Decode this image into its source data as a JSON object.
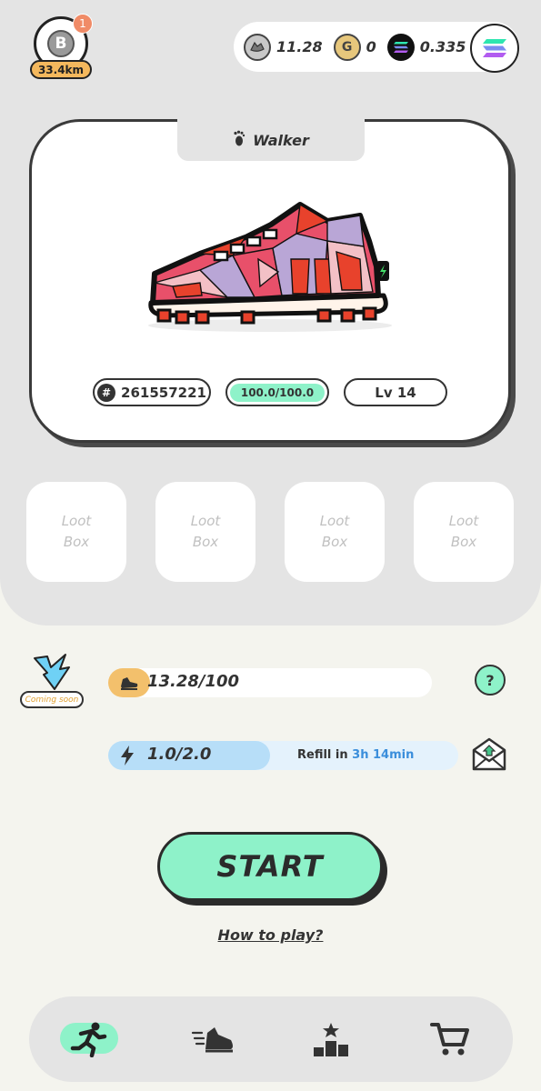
{
  "header": {
    "btc_badge": {
      "coin": "B",
      "notifications": "1",
      "distance": "33.4km"
    },
    "balances": [
      {
        "icon": "gst-token-icon",
        "value": "11.28"
      },
      {
        "icon": "gmt-token-icon",
        "value": "0",
        "symbol": "G"
      },
      {
        "icon": "sol-token-icon",
        "value": "0.335"
      }
    ]
  },
  "sneaker": {
    "type_label": "Walker",
    "id": "261557221",
    "id_prefix": "#",
    "durability": "100.0/100.0",
    "level": "Lv 14",
    "colors": {
      "primary": "#e8506a",
      "secondary": "#b9a6d6",
      "accent": "#e8422c",
      "light": "#f3c0c6"
    }
  },
  "loot_boxes": [
    {
      "label_1": "Loot",
      "label_2": "Box"
    },
    {
      "label_1": "Loot",
      "label_2": "Box"
    },
    {
      "label_1": "Loot",
      "label_2": "Box"
    },
    {
      "label_1": "Loot",
      "label_2": "Box"
    }
  ],
  "boost": {
    "tag": "Coming soon"
  },
  "steps": {
    "value": "13.28/100",
    "progress": 0.1328
  },
  "energy": {
    "value": "1.0/2.0",
    "progress": 0.5,
    "refill_label": "Refill in",
    "refill_time": "3h 14min"
  },
  "help": {
    "label": "?"
  },
  "start": {
    "label": "START"
  },
  "how_to_play": {
    "label": "How to play?"
  },
  "nav": {
    "items": [
      {
        "name": "run",
        "icon": "runner-icon",
        "active": true
      },
      {
        "name": "sneakers",
        "icon": "sneaker-icon",
        "active": false
      },
      {
        "name": "rank",
        "icon": "podium-icon",
        "active": false
      },
      {
        "name": "shop",
        "icon": "cart-icon",
        "active": false
      }
    ]
  },
  "theme": {
    "mint": "#8ef2c9",
    "panel": "#e4e4e4",
    "background": "#f4f4ee",
    "energy_blue": "#b7def8",
    "steps_orange": "#f3c06c"
  }
}
